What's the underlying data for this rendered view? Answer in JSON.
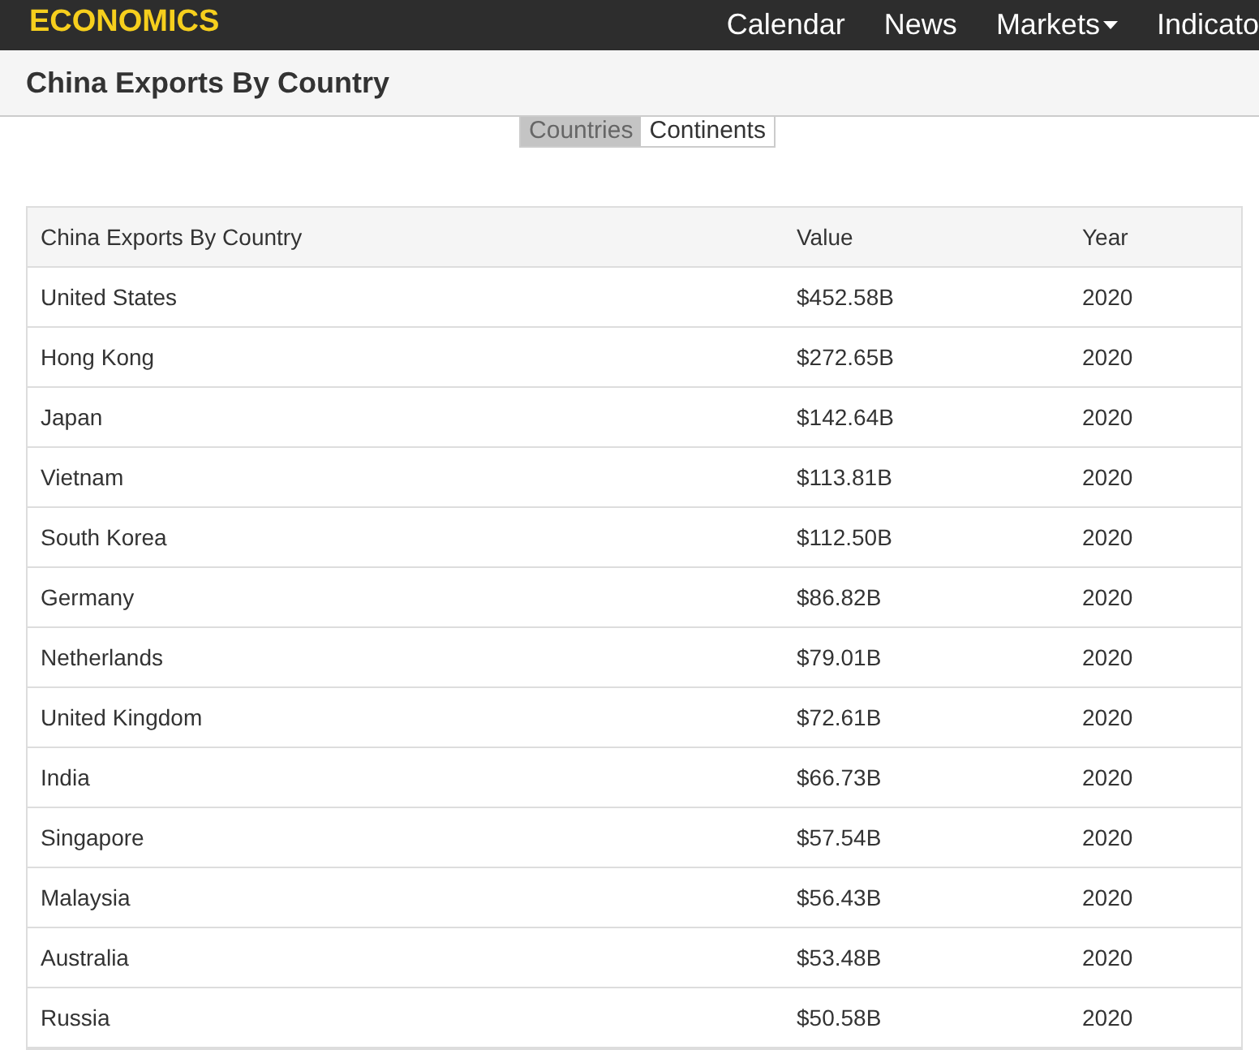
{
  "brand": {
    "name": "ECONOMICS"
  },
  "nav": [
    {
      "label": "Calendar",
      "dropdown": false
    },
    {
      "label": "News",
      "dropdown": false
    },
    {
      "label": "Markets",
      "dropdown": true
    },
    {
      "label": "Indicato",
      "dropdown": false
    }
  ],
  "page_title": "China Exports By Country",
  "toggle": [
    {
      "label": "Countries",
      "selected": true
    },
    {
      "label": "Continents",
      "selected": false
    }
  ],
  "table": {
    "columns": [
      "China Exports By Country",
      "Value",
      "Year"
    ],
    "rows": [
      [
        "United States",
        "$452.58B",
        "2020"
      ],
      [
        "Hong Kong",
        "$272.65B",
        "2020"
      ],
      [
        "Japan",
        "$142.64B",
        "2020"
      ],
      [
        "Vietnam",
        "$113.81B",
        "2020"
      ],
      [
        "South Korea",
        "$112.50B",
        "2020"
      ],
      [
        "Germany",
        "$86.82B",
        "2020"
      ],
      [
        "Netherlands",
        "$79.01B",
        "2020"
      ],
      [
        "United Kingdom",
        "$72.61B",
        "2020"
      ],
      [
        "India",
        "$66.73B",
        "2020"
      ],
      [
        "Singapore",
        "$57.54B",
        "2020"
      ],
      [
        "Malaysia",
        "$56.43B",
        "2020"
      ],
      [
        "Australia",
        "$53.48B",
        "2020"
      ],
      [
        "Russia",
        "$50.58B",
        "2020"
      ]
    ]
  }
}
